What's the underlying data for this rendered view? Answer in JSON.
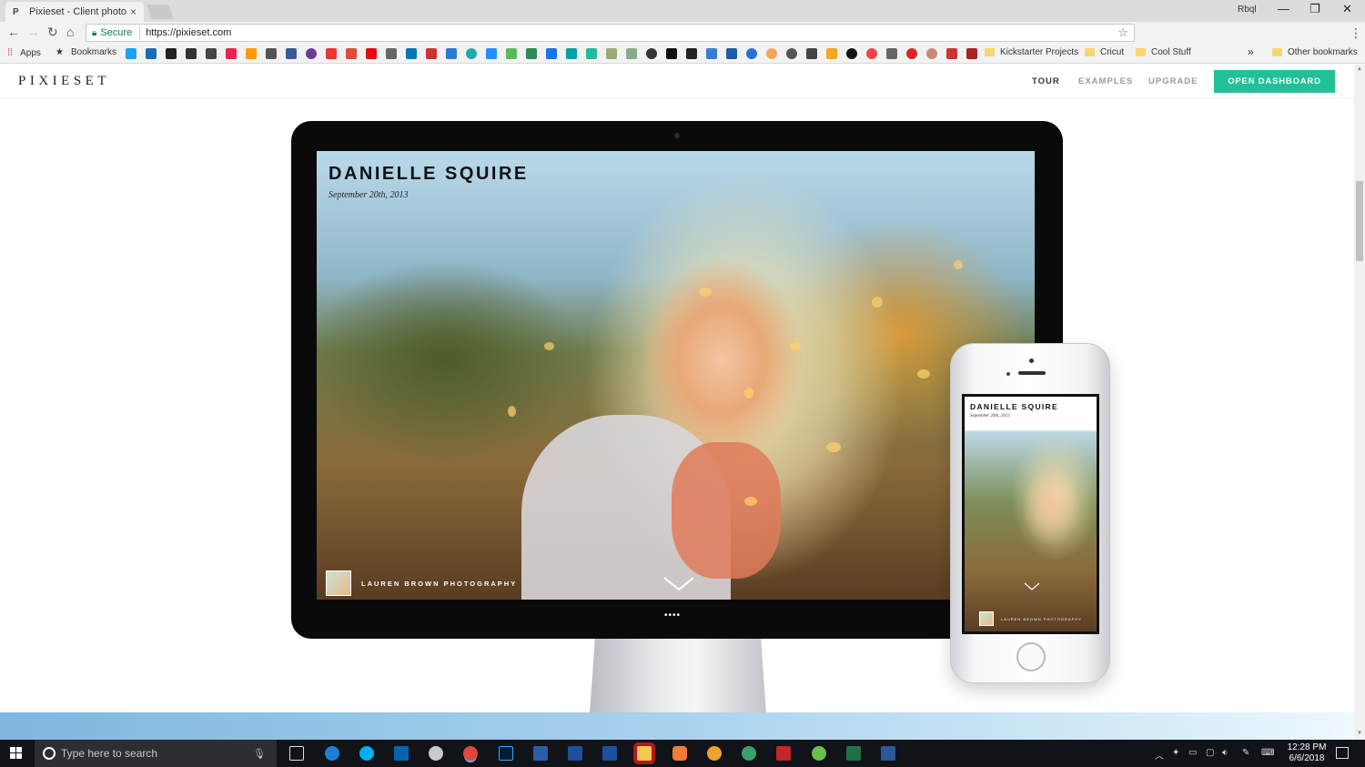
{
  "browser": {
    "tab_title": "Pixieset - Client photo ga",
    "tab_favicon": "P",
    "profile_name": "Rbql",
    "secure_label": "Secure",
    "url": "https://pixieset.com"
  },
  "bookmarks": {
    "apps_label": "Apps",
    "bookmarks_label": "Bookmarks",
    "folders": [
      "Kickstarter Projects",
      "Cricut",
      "Cool Stuff"
    ],
    "overflow": "»",
    "other_label": "Other bookmarks"
  },
  "site": {
    "logo": "PIXIESET",
    "nav": [
      "TOUR",
      "EXAMPLES",
      "UPGRADE"
    ],
    "cta_label": "OPEN DASHBOARD",
    "accent_color": "#21c096"
  },
  "gallery": {
    "title": "DANIELLE SQUIRE",
    "date": "September 20th, 2013",
    "photographer": "LAUREN BROWN PHOTOGRAPHY",
    "pager_dots": "••••"
  },
  "taskbar": {
    "search_placeholder": "Type here to search",
    "time": "12:28 PM",
    "date": "6/6/2018",
    "apps": [
      "edge-icon",
      "skype-icon",
      "outlook-icon",
      "paint-icon",
      "chrome-icon",
      "photoshop-icon",
      "revit-icon",
      "revit-icon",
      "revit-icon",
      "explorer-icon",
      "app-icon",
      "app-icon",
      "app-icon",
      "filezilla-icon",
      "app-icon",
      "excel-icon",
      "word-icon"
    ]
  }
}
